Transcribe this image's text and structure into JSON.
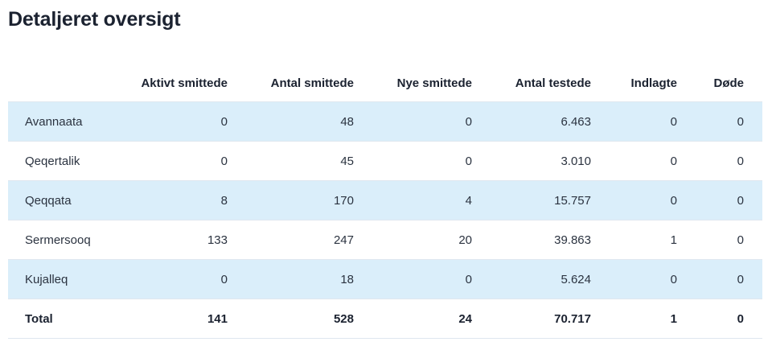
{
  "page": {
    "title": "Detaljeret oversigt"
  },
  "table": {
    "columns": [
      "",
      "Aktivt smittede",
      "Antal smittede",
      "Nye smittede",
      "Antal testede",
      "Indlagte",
      "Døde"
    ],
    "rows": [
      {
        "name": "Avannaata",
        "values": [
          "0",
          "48",
          "0",
          "6.463",
          "0",
          "0"
        ]
      },
      {
        "name": "Qeqertalik",
        "values": [
          "0",
          "45",
          "0",
          "3.010",
          "0",
          "0"
        ]
      },
      {
        "name": "Qeqqata",
        "values": [
          "8",
          "170",
          "4",
          "15.757",
          "0",
          "0"
        ]
      },
      {
        "name": "Sermersooq",
        "values": [
          "133",
          "247",
          "20",
          "39.863",
          "1",
          "0"
        ]
      },
      {
        "name": "Kujalleq",
        "values": [
          "0",
          "18",
          "0",
          "5.624",
          "0",
          "0"
        ]
      }
    ],
    "total": {
      "name": "Total",
      "values": [
        "141",
        "528",
        "24",
        "70.717",
        "1",
        "0"
      ]
    },
    "shaded_row_color": "#daeefa"
  }
}
